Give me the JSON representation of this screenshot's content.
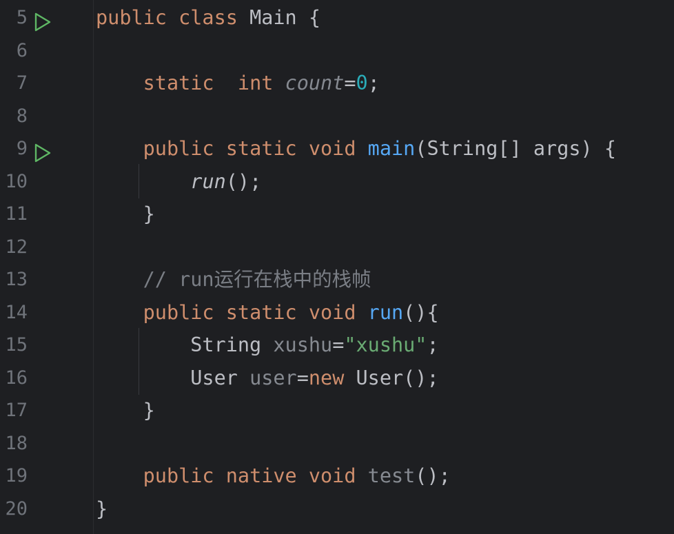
{
  "editor": {
    "lines": [
      {
        "num": "5",
        "run_gutter": true,
        "tokens": [
          {
            "t": "public ",
            "c": "kw"
          },
          {
            "t": "class ",
            "c": "kw"
          },
          {
            "t": "Main {",
            "c": "ph"
          }
        ]
      },
      {
        "num": "6",
        "run_gutter": false,
        "tokens": []
      },
      {
        "num": "7",
        "run_gutter": false,
        "tokens": [
          {
            "t": "    ",
            "c": "ph"
          },
          {
            "t": "static  ",
            "c": "kw"
          },
          {
            "t": "int ",
            "c": "kw"
          },
          {
            "t": "count",
            "c": "unused it"
          },
          {
            "t": "=",
            "c": "ph"
          },
          {
            "t": "0",
            "c": "num"
          },
          {
            "t": ";",
            "c": "ph"
          }
        ]
      },
      {
        "num": "8",
        "run_gutter": false,
        "tokens": []
      },
      {
        "num": "9",
        "run_gutter": true,
        "tokens": [
          {
            "t": "    ",
            "c": "ph"
          },
          {
            "t": "public ",
            "c": "kw"
          },
          {
            "t": "static ",
            "c": "kw"
          },
          {
            "t": "void ",
            "c": "kw"
          },
          {
            "t": "main",
            "c": "fn"
          },
          {
            "t": "(String[] args) {",
            "c": "ph"
          }
        ]
      },
      {
        "num": "10",
        "run_gutter": false,
        "tokens": [
          {
            "t": "        ",
            "c": "ph"
          },
          {
            "t": "run",
            "c": "ph it"
          },
          {
            "t": "();",
            "c": "ph"
          }
        ]
      },
      {
        "num": "11",
        "run_gutter": false,
        "tokens": [
          {
            "t": "    }",
            "c": "ph"
          }
        ]
      },
      {
        "num": "12",
        "run_gutter": false,
        "tokens": []
      },
      {
        "num": "13",
        "run_gutter": false,
        "tokens": [
          {
            "t": "    // run",
            "c": "cm"
          },
          {
            "t": "运行在栈中的栈帧",
            "c": "cm cm-cjk"
          }
        ]
      },
      {
        "num": "14",
        "run_gutter": false,
        "tokens": [
          {
            "t": "    ",
            "c": "ph"
          },
          {
            "t": "public ",
            "c": "kw"
          },
          {
            "t": "static ",
            "c": "kw"
          },
          {
            "t": "void ",
            "c": "kw"
          },
          {
            "t": "run",
            "c": "fn"
          },
          {
            "t": "(){",
            "c": "ph"
          }
        ]
      },
      {
        "num": "15",
        "run_gutter": false,
        "tokens": [
          {
            "t": "        String ",
            "c": "ph"
          },
          {
            "t": "xushu",
            "c": "unused"
          },
          {
            "t": "=",
            "c": "ph"
          },
          {
            "t": "\"xushu\"",
            "c": "str"
          },
          {
            "t": ";",
            "c": "ph"
          }
        ]
      },
      {
        "num": "16",
        "run_gutter": false,
        "tokens": [
          {
            "t": "        User ",
            "c": "ph"
          },
          {
            "t": "user",
            "c": "unused"
          },
          {
            "t": "=",
            "c": "ph"
          },
          {
            "t": "new ",
            "c": "kw"
          },
          {
            "t": "User();",
            "c": "ph"
          }
        ]
      },
      {
        "num": "17",
        "run_gutter": false,
        "tokens": [
          {
            "t": "    }",
            "c": "ph"
          }
        ]
      },
      {
        "num": "18",
        "run_gutter": false,
        "tokens": []
      },
      {
        "num": "19",
        "run_gutter": false,
        "tokens": [
          {
            "t": "    ",
            "c": "ph"
          },
          {
            "t": "public ",
            "c": "kw"
          },
          {
            "t": "native ",
            "c": "kw"
          },
          {
            "t": "void ",
            "c": "kw"
          },
          {
            "t": "test",
            "c": "unused"
          },
          {
            "t": "();",
            "c": "ph"
          }
        ]
      },
      {
        "num": "20",
        "run_gutter": false,
        "tokens": [
          {
            "t": "}",
            "c": "ph"
          }
        ]
      }
    ]
  },
  "icons": {
    "run_gutter": "run-play-icon"
  },
  "colors": {
    "background": "#1e1f22",
    "keyword": "#cf8e6d",
    "function": "#56a8f5",
    "number": "#2aacb8",
    "string": "#6aab73",
    "comment": "#7a7e85",
    "plain": "#bcbec4",
    "line_number": "#6f737a",
    "run_icon": "#5fb865"
  }
}
